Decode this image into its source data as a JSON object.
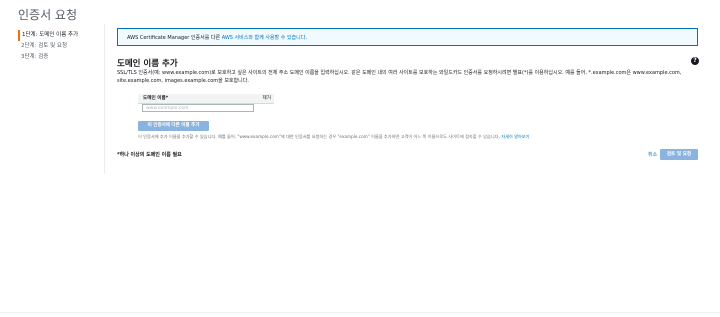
{
  "page": {
    "title": "인증서 요청"
  },
  "steps": [
    {
      "label": "1단계: 도메인 이름 추가",
      "active": true
    },
    {
      "label": "2단계: 검토 및 요청",
      "active": false
    },
    {
      "label": "3단계: 검증",
      "active": false
    }
  ],
  "info": {
    "text_before": "AWS Certificate Manager 인증서를 다른 ",
    "link": "AWS 서비스와 함께 사용할 수 있습니다",
    "text_after": "."
  },
  "section": {
    "title": "도메인 이름 추가",
    "description": "SSL/TLS 인증서(예: www.example.com)로 보호하고 싶은 사이트의 전체 주소 도메인 이름을 입력하십시오. 같은 도메인 내의 여러 사이트를 보호하는 와일드카드 인증서를 요청하시려면 별표(*)를 이용하십시오. 예를 들어, *.example.com은 www.example.com, site.example.com, images.example.com을 보호합니다."
  },
  "table": {
    "header_name": "도메인 이름*",
    "header_remove": "제거",
    "input_value": "",
    "input_placeholder": "www.example.com"
  },
  "buttons": {
    "add_name": "이 인증서에 다른 이름 추가",
    "cancel": "취소",
    "next": "검토 및 요청"
  },
  "tip": {
    "text": "이 인증서에 추가 이름을 추가할 수 있습니다. 예를 들어, \"www.example.com\"에 대한 인증서를 요청하는 경우 \"example.com\" 이름을 추가하면 고객이 어느 쪽 이름으로도 사이트에 접속할 수 있습니다. ",
    "link": "자세히 알아보기"
  },
  "footer": {
    "required_note": "*하나 이상의 도메인 이름 필요"
  },
  "colors": {
    "accent": "#ec7211",
    "link": "#0073bb",
    "button_disabled": "#8ab4df",
    "info_bg": "#f1faff"
  },
  "icons": {
    "help": "help-icon"
  }
}
